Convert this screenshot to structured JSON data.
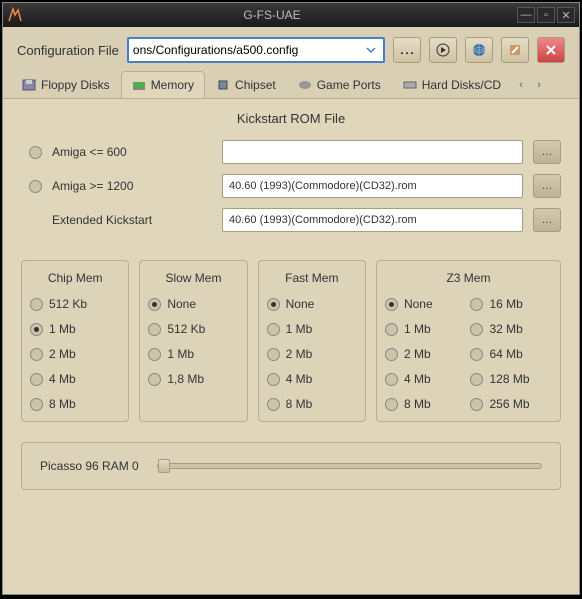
{
  "window": {
    "title": "G-FS-UAE"
  },
  "toolbar": {
    "config_label": "Configuration File",
    "config_value": "ons/Configurations/a500.config"
  },
  "tabs": {
    "items": [
      {
        "label": "Floppy Disks"
      },
      {
        "label": "Memory"
      },
      {
        "label": "Chipset"
      },
      {
        "label": "Game Ports"
      },
      {
        "label": "Hard Disks/CD"
      }
    ]
  },
  "kickstart": {
    "title": "Kickstart ROM File",
    "rows": [
      {
        "label": "Amiga <= 600",
        "value": "",
        "radio": true,
        "selected": false
      },
      {
        "label": "Amiga >= 1200",
        "value": "40.60 (1993)(Commodore)(CD32).rom",
        "radio": true,
        "selected": false
      },
      {
        "label": "Extended Kickstart",
        "value": "40.60 (1993)(Commodore)(CD32).rom",
        "radio": false,
        "selected": false
      }
    ]
  },
  "mem": {
    "chip": {
      "title": "Chip Mem",
      "opts": [
        "512 Kb",
        "1 Mb",
        "2 Mb",
        "4 Mb",
        "8 Mb"
      ],
      "selected": 1
    },
    "slow": {
      "title": "Slow Mem",
      "opts": [
        "None",
        "512 Kb",
        "1 Mb",
        "1,8 Mb"
      ],
      "selected": 0
    },
    "fast": {
      "title": "Fast Mem",
      "opts": [
        "None",
        "1 Mb",
        "2 Mb",
        "4 Mb",
        "8 Mb"
      ],
      "selected": 0
    },
    "z3": {
      "title": "Z3 Mem",
      "col1": [
        "None",
        "1 Mb",
        "2 Mb",
        "4 Mb",
        "8 Mb"
      ],
      "col2": [
        "16 Mb",
        "32 Mb",
        "64 Mb",
        "128 Mb",
        "256 Mb"
      ],
      "selected": 0
    }
  },
  "slider": {
    "label": "Picasso 96 RAM 0"
  }
}
